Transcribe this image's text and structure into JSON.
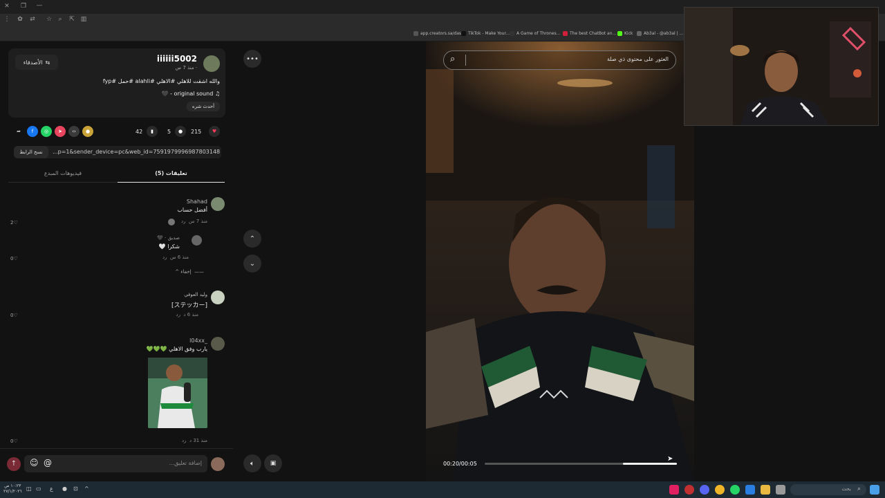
{
  "bookmarks": [
    {
      "label": "app.creators.sa/das...",
      "color": "#555555"
    },
    {
      "label": "TikTok - Make Your...",
      "color": "#111111"
    },
    {
      "label": "A Game of Thrones...",
      "color": "#333333"
    },
    {
      "label": "The best ChatBot an...",
      "color": "#d21f3c"
    },
    {
      "label": "Kick",
      "color": "#53fc18"
    },
    {
      "label": "Ab3al - @ab3al | ...",
      "color": "#666666"
    }
  ],
  "post": {
    "username": "iiiiii5002",
    "meta": "· منذ 7 س",
    "friends_button": "الأصدقاء",
    "caption": "والله اشقت للاهلي #الاهلي #alahli #حمل #fyp",
    "sound": "original sound - 🖤",
    "recent_share": "أحدث شره",
    "likes": "215",
    "comments": "5",
    "saves": "42",
    "link_text": "...p=1&sender_device=pc&web_id=7591979996987803148",
    "copy_button": "نسخ الرابط"
  },
  "tabs": {
    "comments": "(5) تعليقات",
    "creator_videos": "فيديوهات المبدع"
  },
  "comments": [
    {
      "author": "Shahad",
      "text": "أفضل حساب",
      "time": "منذ 7 س",
      "reply": "رد",
      "likes": "2"
    },
    {
      "author": "صديق · 🖤",
      "text": "شكرا 🤍",
      "time": "منذ 6 س",
      "reply": "رد",
      "likes": "0"
    },
    {
      "author": "وليد العوفي",
      "text": "[ステッカー]",
      "time": "منذ 6 د",
      "reply": "رد",
      "likes": "0"
    },
    {
      "author": "_l04xx",
      "text": "يارب وفق الاهلي 💚💚💚",
      "time": "منذ 31 د",
      "reply": "رد",
      "likes": "0"
    }
  ],
  "hide_label": "إخفاء",
  "add_comment_placeholder": "إضافة تعليق...",
  "search": {
    "placeholder": "العثور على محتوى ذي صلة"
  },
  "video": {
    "time": "00:20/00:05",
    "progress": 0.28
  },
  "taskbar": {
    "clock_time": "١٠:٢٣ ص",
    "clock_date": "٢٧/١/٢٠٢٦",
    "search_label": "بحث"
  }
}
